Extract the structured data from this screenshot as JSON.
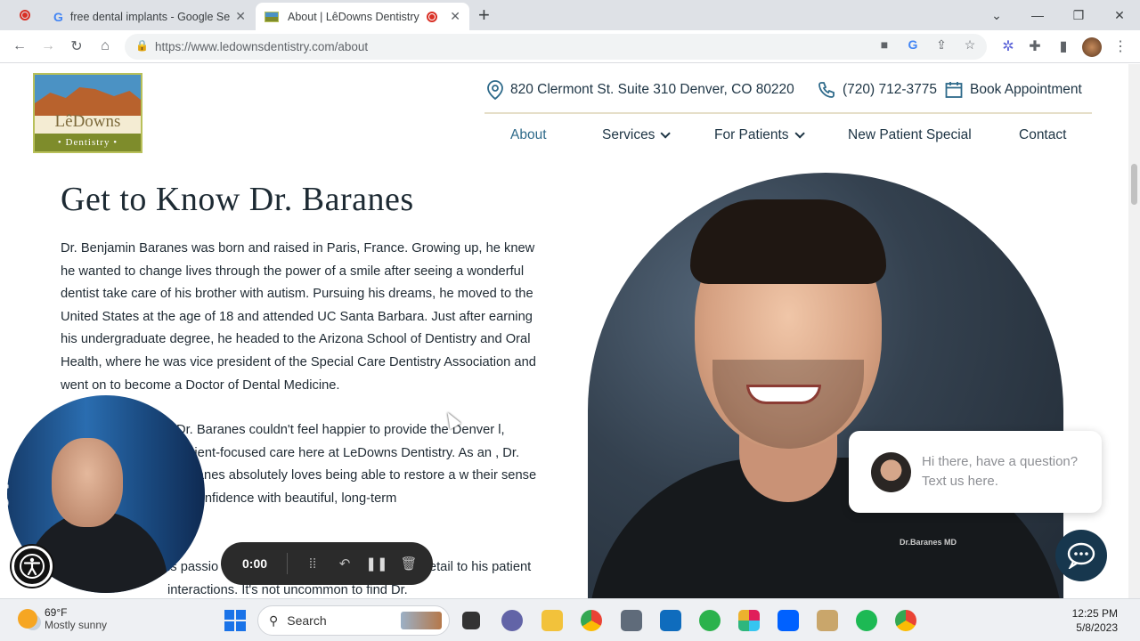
{
  "browser": {
    "tabs": [
      {
        "title": "free dental implants - Google Se",
        "active": false
      },
      {
        "title": "About | LêDowns Dentistry",
        "active": true
      }
    ],
    "new_tab": "+",
    "url": "https://www.ledownsdentistry.com/about"
  },
  "site": {
    "logo": {
      "name": "LêDowns",
      "sub": "• Dentistry •"
    },
    "address": "820 Clermont St. Suite 310 Denver, CO 80220",
    "phone": "(720) 712-3775",
    "book": "Book Appointment",
    "nav": [
      {
        "label": "About",
        "active": true,
        "dropdown": false
      },
      {
        "label": "Services",
        "active": false,
        "dropdown": true
      },
      {
        "label": "For Patients",
        "active": false,
        "dropdown": true
      },
      {
        "label": "New Patient Special",
        "active": false,
        "dropdown": false
      },
      {
        "label": "Contact",
        "active": false,
        "dropdown": false
      }
    ],
    "heading": "Get to Know Dr. Baranes",
    "para1": "Dr. Benjamin Baranes was born and raised in Paris, France. Growing up, he knew he wanted to change lives through the power of a smile after seeing a wonderful dentist take care of his brother with autism. Pursuing his dreams, he moved to the United States at the age of 18 and attended UC Santa Barbara. Just after earning his undergraduate degree, he headed to the Arizona School of Dentistry and Oral Health, where he was vice president of the Special Care Dentistry Association and went on to become a Doctor of Dental Medicine.",
    "para2": "Dr. Baranes couldn't feel happier to provide the Denver l, patient-focused care here at LeDowns Dentistry. As an , Dr. Baranes absolutely loves being able to restore a w their sense of confidence with beautiful, long-term",
    "para3": "is passio                                        same enthusiasm and attention to detail to his patient interactions. It's not uncommon to find Dr.",
    "photo_badge": "Dr.Baranes MD",
    "chat_text": "Hi there, have a question? Text us here."
  },
  "recorder": {
    "time": "0:00"
  },
  "taskbar": {
    "weather_temp": "69°F",
    "weather_desc": "Mostly sunny",
    "search_label": "Search",
    "time": "12:25 PM",
    "date": "5/8/2023"
  },
  "colors": {
    "navy": "#1d3444",
    "accent": "#2e6a8a",
    "chat": "#17374e"
  }
}
